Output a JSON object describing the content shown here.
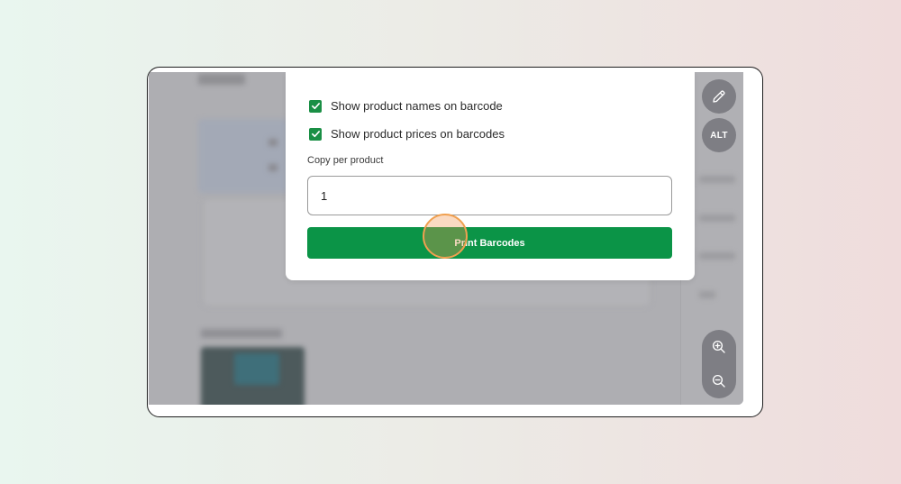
{
  "dialog": {
    "option_names": "Show product names on barcode",
    "option_prices": "Show product prices on barcodes",
    "copy_label": "Copy per product",
    "copy_value": "1",
    "print_button": "Print Barcodes"
  },
  "toolbar": {
    "edit_icon": "pencil-icon",
    "alt_label": "ALT",
    "zoom_in_icon": "zoom-in-icon",
    "zoom_out_icon": "zoom-out-icon"
  },
  "colors": {
    "accent_green": "#0b9447",
    "checkbox_green": "#1a8f45",
    "click_highlight": "#f0a050",
    "overlay_grey": "#aeaeb2"
  }
}
